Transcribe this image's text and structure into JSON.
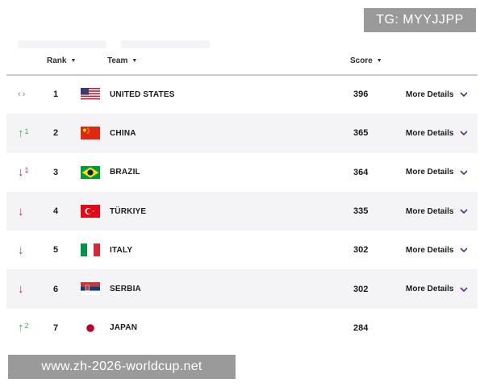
{
  "watermark_top": "TG: MYYJJPP",
  "watermark_bottom": "www.zh-2026-worldcup.net",
  "header": {
    "rank_label": "Rank",
    "team_label": "Team",
    "score_label": "Score"
  },
  "colors": {
    "up": "#3fae58",
    "down": "#c8334a",
    "same": "#8a8a8a",
    "chevron": "#5a2d91"
  },
  "rows": [
    {
      "trend": "same",
      "trend_value": "",
      "rank": "1",
      "team": "UNITED STATES",
      "flag": "usa-flag-icon",
      "score": "396",
      "details": "More Details"
    },
    {
      "trend": "up",
      "trend_value": "1",
      "rank": "2",
      "team": "CHINA",
      "flag": "china-flag-icon",
      "score": "365",
      "details": "More Details"
    },
    {
      "trend": "down",
      "trend_value": "1",
      "rank": "3",
      "team": "BRAZIL",
      "flag": "brazil-flag-icon",
      "score": "364",
      "details": "More Details"
    },
    {
      "trend": "down",
      "trend_value": "",
      "rank": "4",
      "team": "TÜRKIYE",
      "flag": "turkiye-flag-icon",
      "score": "335",
      "details": "More Details"
    },
    {
      "trend": "down",
      "trend_value": "",
      "rank": "5",
      "team": "ITALY",
      "flag": "italy-flag-icon",
      "score": "302",
      "details": "More Details"
    },
    {
      "trend": "down",
      "trend_value": "",
      "rank": "6",
      "team": "SERBIA",
      "flag": "serbia-flag-icon",
      "score": "302",
      "details": "More Details"
    },
    {
      "trend": "up",
      "trend_value": "2",
      "rank": "7",
      "team": "JAPAN",
      "flag": "japan-flag-icon",
      "score": "284",
      "details": ""
    }
  ]
}
